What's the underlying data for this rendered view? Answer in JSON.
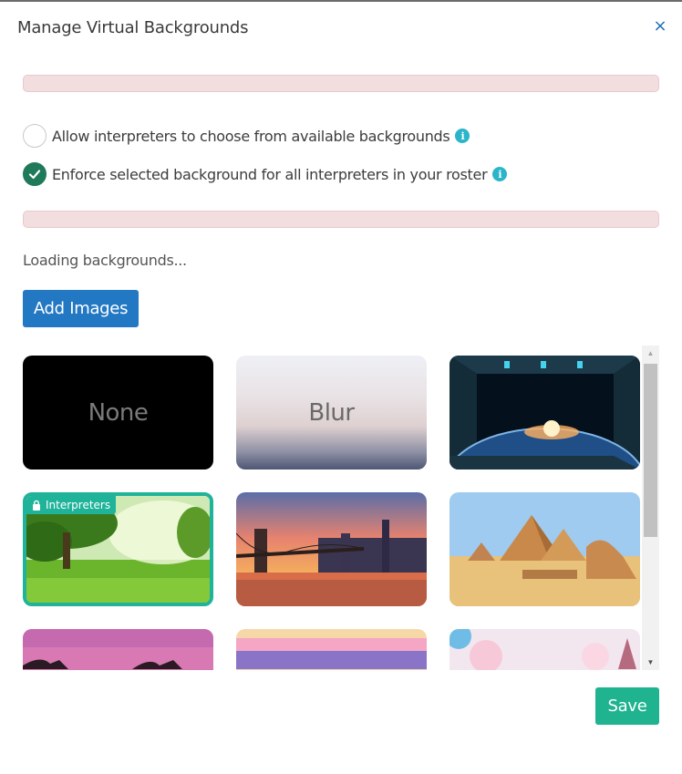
{
  "dialog": {
    "title": "Manage Virtual Backgrounds",
    "close_icon": "×"
  },
  "options": {
    "allow_label": "Allow interpreters to choose from available backgrounds",
    "allow_checked": false,
    "enforce_label": "Enforce selected background for all interpreters in your roster",
    "enforce_checked": true,
    "info_glyph": "i"
  },
  "status": {
    "loading_text": "Loading backgrounds..."
  },
  "buttons": {
    "add_images": "Add Images",
    "save": "Save"
  },
  "backgrounds": {
    "none_label": "None",
    "blur_label": "Blur",
    "selected_badge": "Interpreters",
    "tiles": [
      "none",
      "blur",
      "space-station",
      "green-park",
      "brooklyn-bridge",
      "pyramids",
      "pink-sunset",
      "pastel-sky",
      "snowy-trees"
    ]
  },
  "scrollbar": {
    "up_arrow": "▲",
    "down_arrow": "▼",
    "position": 0.0
  },
  "colors": {
    "primary_button": "#2378c3",
    "save_button": "#1fb38f",
    "selected_border": "#1fb39a",
    "info_icon": "#2cb5c9",
    "checked_radio": "#1f7a5a",
    "alert_bg": "#f2dede",
    "close_icon": "#1f6db3"
  }
}
